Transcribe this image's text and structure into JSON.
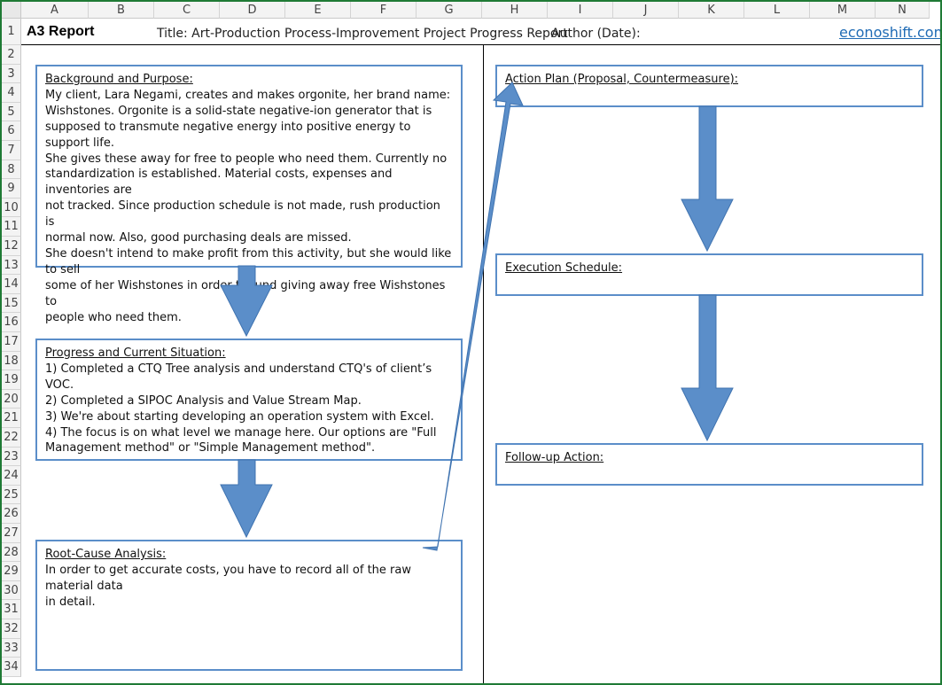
{
  "sheet": {
    "columns": [
      "A",
      "B",
      "C",
      "D",
      "E",
      "F",
      "G",
      "H",
      "I",
      "J",
      "K",
      "L",
      "M",
      "N"
    ],
    "rows": [
      "1",
      "2",
      "3",
      "4",
      "5",
      "6",
      "7",
      "8",
      "9",
      "10",
      "11",
      "12",
      "13",
      "14",
      "15",
      "16",
      "17",
      "18",
      "19",
      "20",
      "21",
      "22",
      "23",
      "24",
      "25",
      "26",
      "27",
      "28",
      "29",
      "30",
      "31",
      "32",
      "33",
      "34"
    ]
  },
  "header": {
    "label": "A3 Report",
    "title": "Title: Art-Production Process-Improvement Project Progress Report",
    "author": "Author (Date):",
    "link": "econoshift.com"
  },
  "left": {
    "background": {
      "heading": "Background and Purpose:",
      "body": "My client, Lara Negami, creates and makes orgonite, her brand name:\nWishstones.  Orgonite is a solid-state negative-ion generator that is\nsupposed to transmute negative energy into positive energy to support life.\nShe gives these away for free to people who need them.  Currently no\nstandardization is established.  Material costs, expenses and inventories are\nnot tracked.  Since production schedule is not made, rush production is\nnormal now.  Also, good purchasing deals are missed.\nShe doesn't intend to make profit from this activity, but she would like to sell\nsome of her Wishstones in order to fund giving away free Wishstones to\npeople who need them."
    },
    "progress": {
      "heading": "Progress and Current Situation:",
      "body": "1) Completed a CTQ Tree analysis and understand CTQ's of client’s VOC.\n2) Completed a SIPOC Analysis and Value Stream Map.\n3) We're about starting developing an operation system with Excel.\n4) The focus is on what level we manage here.  Our options are \"Full\nManagement method\" or \"Simple Management method\"."
    },
    "root_cause": {
      "heading": "Root-Cause Analysis:",
      "body": "In order to get accurate costs, you have to record all of the raw material data\nin detail."
    }
  },
  "right": {
    "action_plan": {
      "heading": "Action Plan (Proposal, Countermeasure):"
    },
    "execution": {
      "heading": "Execution Schedule:"
    },
    "follow_up": {
      "heading": "Follow-up Action:"
    }
  },
  "colors": {
    "arrow": "#5b8ec9",
    "box_border": "#5b8ec9",
    "frame": "#1f7a35",
    "link": "#1f6bb5"
  }
}
